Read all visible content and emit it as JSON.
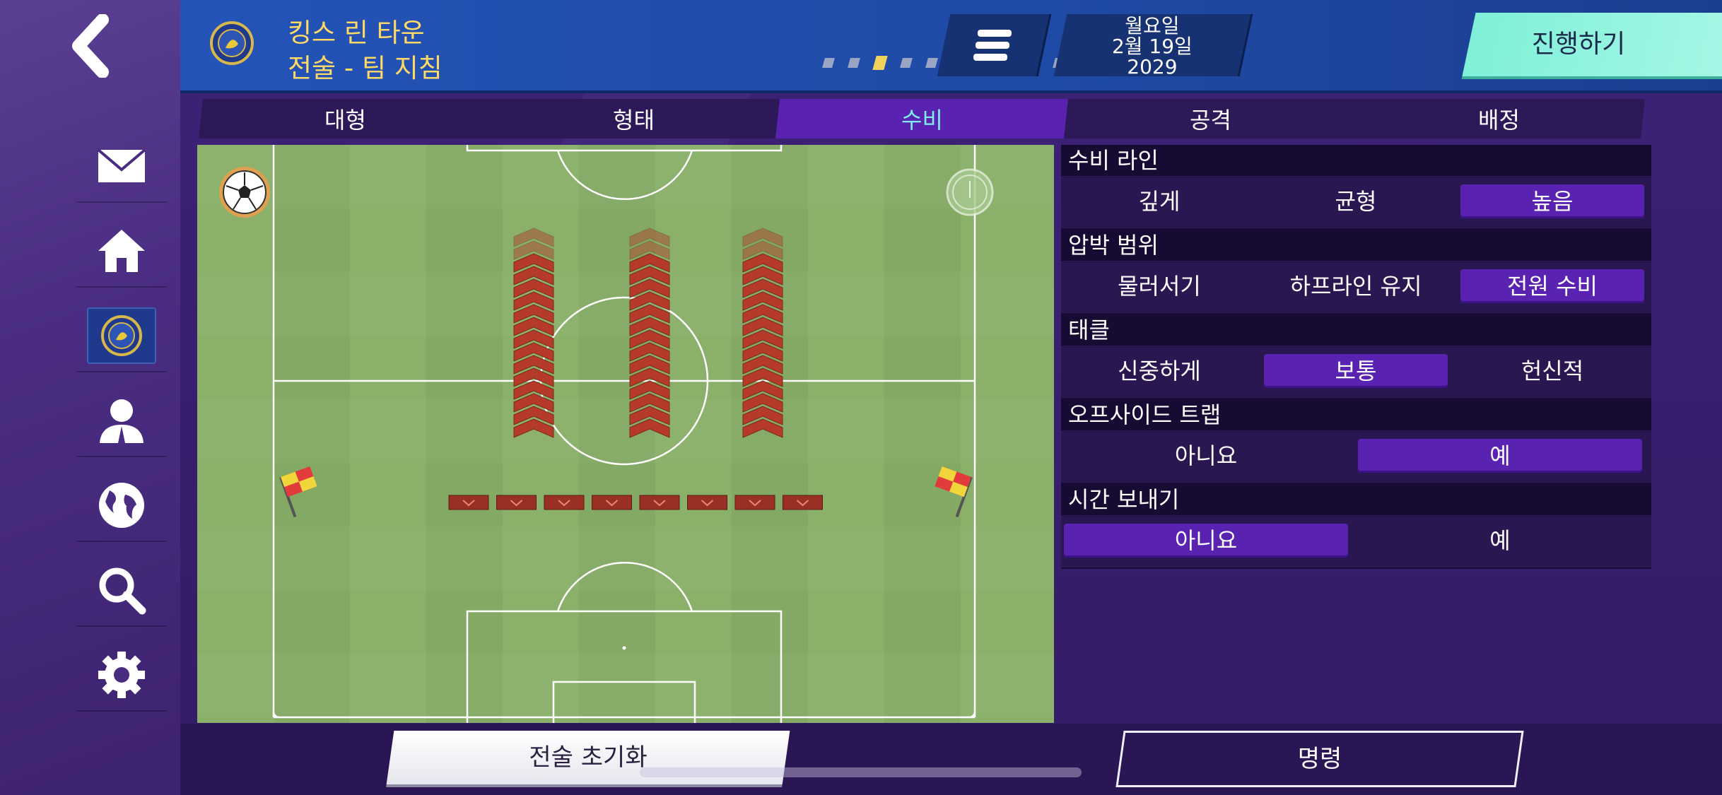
{
  "header": {
    "club_name": "킹스 린 타운",
    "screen_title": "전술 - 팀 지침",
    "progress_dots_total": 11,
    "progress_dots_active_index": 2,
    "date": {
      "weekday": "월요일",
      "day": "2월 19일",
      "year": "2029"
    },
    "continue_label": "진행하기"
  },
  "sidebar": {
    "items": [
      {
        "name": "mail",
        "icon": "envelope-icon"
      },
      {
        "name": "home",
        "icon": "home-icon"
      },
      {
        "name": "club",
        "icon": "club-crest-icon",
        "active": true
      },
      {
        "name": "manager",
        "icon": "manager-icon"
      },
      {
        "name": "world",
        "icon": "globe-icon"
      },
      {
        "name": "search",
        "icon": "search-icon"
      },
      {
        "name": "settings",
        "icon": "gear-icon"
      }
    ]
  },
  "tabs": [
    {
      "label": "대형",
      "active": false
    },
    {
      "label": "형태",
      "active": false
    },
    {
      "label": "수비",
      "active": true
    },
    {
      "label": "공격",
      "active": false
    },
    {
      "label": "배정",
      "active": false
    }
  ],
  "settings": [
    {
      "title": "수비 라인",
      "options": [
        "깊게",
        "균형",
        "높음"
      ],
      "selected": 2
    },
    {
      "title": "압박 범위",
      "options": [
        "물러서기",
        "하프라인 유지",
        "전원 수비"
      ],
      "selected": 2
    },
    {
      "title": "태클",
      "options": [
        "신중하게",
        "보통",
        "헌신적"
      ],
      "selected": 1
    },
    {
      "title": "오프사이드 트랩",
      "options": [
        "아니요",
        "예"
      ],
      "selected": 1
    },
    {
      "title": "시간 보내기",
      "options": [
        "아니요",
        "예"
      ],
      "selected": 0
    }
  ],
  "bottom": {
    "reset_label": "전술 초기화",
    "command_label": "명령"
  },
  "colors": {
    "accent_selected": "#5a22b0",
    "header_blue": "#2454b8",
    "continue_mint": "#8ff3dd",
    "chevron_red": "#b53a2a",
    "title_gold": "#ffd966"
  }
}
